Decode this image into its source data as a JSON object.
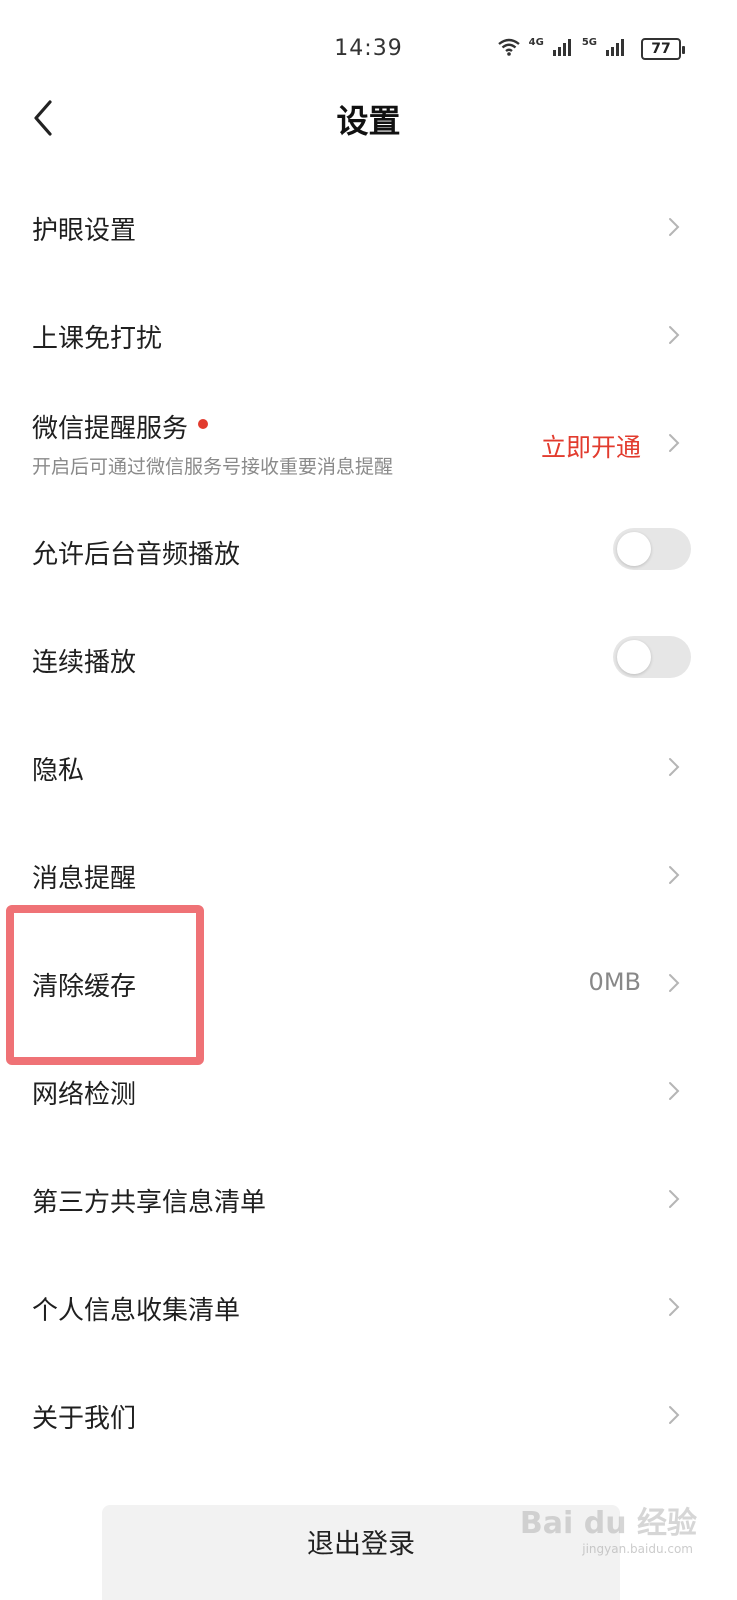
{
  "status_bar": {
    "time": "14:39",
    "net1": "4G",
    "net2": "5G",
    "battery": "77",
    "icons": [
      "wifi-icon",
      "signal-icon",
      "signal-icon",
      "battery-icon"
    ]
  },
  "nav": {
    "title": "设置",
    "back_icon": "chevron-left-icon"
  },
  "items": [
    {
      "label": "护眼设置"
    },
    {
      "label": "上课免打扰"
    },
    {
      "label": "微信提醒服务",
      "subtitle": "开启后可通过微信服务号接收重要消息提醒",
      "value": "立即开通"
    },
    {
      "label": "允许后台音频播放",
      "toggle": "off"
    },
    {
      "label": "连续播放",
      "toggle": "off"
    },
    {
      "label": "隐私"
    },
    {
      "label": "消息提醒"
    },
    {
      "label": "清除缓存",
      "value": "0MB"
    },
    {
      "label": "网络检测"
    },
    {
      "label": "第三方共享信息清单"
    },
    {
      "label": "个人信息收集清单"
    },
    {
      "label": "关于我们"
    }
  ],
  "logout": {
    "label": "退出登录"
  },
  "watermark": {
    "text": "Bai du 经验",
    "sub": "jingyan.baidu.com"
  },
  "colors": {
    "accent_red": "#e23b2e",
    "highlight": "#ef7276",
    "toggle_off": "#e6e6e6"
  }
}
